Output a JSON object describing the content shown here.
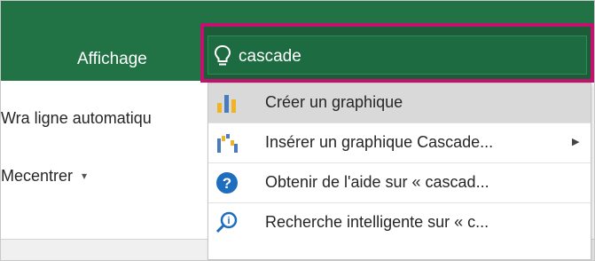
{
  "ribbon": {
    "tab_label": "Affichage",
    "wrap_text_label": "Wra ligne automatiqu",
    "merge_label": "Mecentrer",
    "merge_caret": "▾"
  },
  "tell_me": {
    "value": "cascade",
    "icon": "lightbulb-icon"
  },
  "menu": {
    "items": [
      {
        "label": "Créer un graphique",
        "icon": "bar-chart-icon",
        "highlighted": true
      },
      {
        "label": "Insérer un graphique Cascade...",
        "icon": "waterfall-chart-icon",
        "submenu_arrow": "▶"
      },
      {
        "label": "Obtenir de l'aide sur « cascad...",
        "icon": "help-icon"
      },
      {
        "label": "Recherche intelligente sur « c...",
        "icon": "smart-lookup-icon"
      }
    ]
  },
  "colors": {
    "ribbon_green": "#217346",
    "highlight_border": "#c0136e",
    "help_blue": "#1f6dbf",
    "chart_gold": "#f0b323",
    "chart_blue": "#4a7bbd"
  }
}
